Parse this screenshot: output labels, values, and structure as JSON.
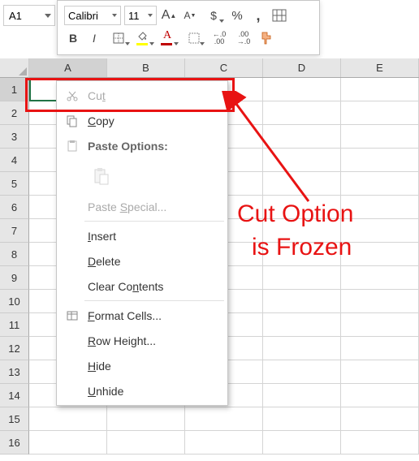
{
  "nameBox": "A1",
  "toolbar": {
    "fontName": "Calibri",
    "fontSize": "11",
    "bold": "B",
    "italic": "I",
    "growA": "A",
    "shrinkA": "A",
    "dollar": "$",
    "percent": "%",
    "comma": ",",
    "incDec": ".0\n.00",
    "decDec": ".00\n.0",
    "fontColorA": "A"
  },
  "columns": [
    "A",
    "B",
    "C",
    "D",
    "E"
  ],
  "rows": [
    "1",
    "2",
    "3",
    "4",
    "5",
    "6",
    "7",
    "8",
    "9",
    "10",
    "11",
    "12",
    "13",
    "14",
    "15",
    "16"
  ],
  "ctx": {
    "cut": "Cu<u>t</u>",
    "copy": "<u>C</u>opy",
    "pasteOptions": "Paste Options:",
    "pasteSpecial": "Paste <u>S</u>pecial...",
    "insert": "<u>I</u>nsert",
    "delete": "<u>D</u>elete",
    "clearContents": "Clear Co<u>n</u>tents",
    "formatCells": "<u>F</u>ormat Cells...",
    "rowHeight": "<u>R</u>ow Height...",
    "hide": "<u>H</u>ide",
    "unhide": "<u>U</u>nhide"
  },
  "annotation": {
    "line1": "Cut Option",
    "line2": "is Frozen"
  },
  "colors": {
    "highlight": "#e81313",
    "excelGreen": "#217346"
  }
}
